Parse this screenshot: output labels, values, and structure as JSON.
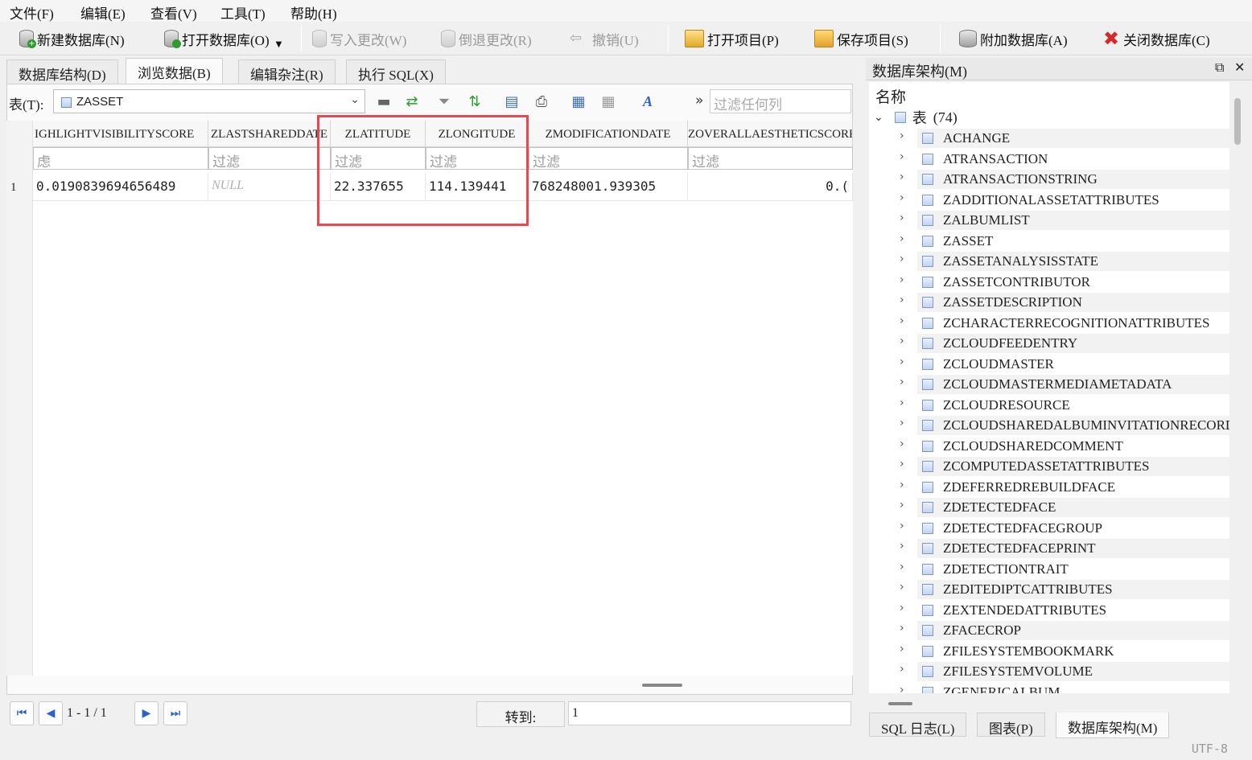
{
  "menu": [
    "文件(F)",
    "编辑(E)",
    "查看(V)",
    "工具(T)",
    "帮助(H)"
  ],
  "toolbar": {
    "new_db": "新建数据库(N)",
    "open_db": "打开数据库(O)",
    "write_changes": "写入更改(W)",
    "revert_changes": "倒退更改(R)",
    "undo": "撤销(U)",
    "open_project": "打开项目(P)",
    "save_project": "保存项目(S)",
    "attach_db": "附加数据库(A)",
    "close_db": "关闭数据库(C)"
  },
  "tabs": [
    "数据库结构(D)",
    "浏览数据(B)",
    "编辑杂注(R)",
    "执行 SQL(X)"
  ],
  "table_bar": {
    "label": "表(T):",
    "selected_table": "ZASSET",
    "filter_any_placeholder": "过滤任何列"
  },
  "grid": {
    "columns": [
      "IGHLIGHTVISIBILITYSCORE",
      "ZLASTSHAREDDATE",
      "ZLATITUDE",
      "ZLONGITUDE",
      "ZMODIFICATIONDATE",
      "ZOVERALLAESTHETICSCORE"
    ],
    "filter_placeholders": [
      "虑",
      "过滤",
      "过滤",
      "过滤",
      "过滤",
      "过滤"
    ],
    "rows": [
      {
        "num": "1",
        "cells": [
          "0.0190839694656489",
          "NULL",
          "22.337655",
          "114.139441",
          "768248001.939305",
          "0.("
        ]
      }
    ]
  },
  "pager": {
    "range": "1 - 1 / 1",
    "goto_label": "转到:",
    "goto_value": "1"
  },
  "right_panel": {
    "title": "数据库架构(M)",
    "header": "名称",
    "root_label": "表",
    "root_count": "(74)",
    "tables": [
      "ACHANGE",
      "ATRANSACTION",
      "ATRANSACTIONSTRING",
      "ZADDITIONALASSETATTRIBUTES",
      "ZALBUMLIST",
      "ZASSET",
      "ZASSETANALYSISSTATE",
      "ZASSETCONTRIBUTOR",
      "ZASSETDESCRIPTION",
      "ZCHARACTERRECOGNITIONATTRIBUTES",
      "ZCLOUDFEEDENTRY",
      "ZCLOUDMASTER",
      "ZCLOUDMASTERMEDIAMETADATA",
      "ZCLOUDRESOURCE",
      "ZCLOUDSHAREDALBUMINVITATIONRECORD",
      "ZCLOUDSHAREDCOMMENT",
      "ZCOMPUTEDASSETATTRIBUTES",
      "ZDEFERREDREBUILDFACE",
      "ZDETECTEDFACE",
      "ZDETECTEDFACEGROUP",
      "ZDETECTEDFACEPRINT",
      "ZDETECTIONTRAIT",
      "ZEDITEDIPTCATTRIBUTES",
      "ZEXTENDEDATTRIBUTES",
      "ZFACECROP",
      "ZFILESYSTEMBOOKMARK",
      "ZFILESYSTEMVOLUME",
      "ZGENERICALBUM"
    ]
  },
  "bottom_tabs": [
    "SQL 日志(L)",
    "图表(P)",
    "数据库架构(M)"
  ],
  "status": {
    "encoding": "UTF-8"
  },
  "colors": {
    "highlight": "#e84850",
    "accent": "#2a62c9"
  }
}
